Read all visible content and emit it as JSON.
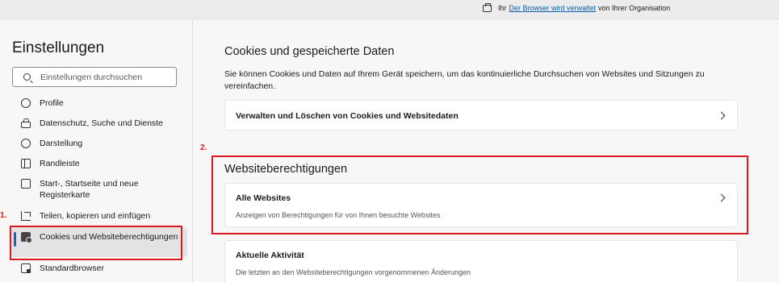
{
  "banner": {
    "prefix": "Ihr",
    "link": "Der Browser wird verwaltet",
    "suffix": "von Ihrer Organisation"
  },
  "sidebar": {
    "title": "Einstellungen",
    "search_placeholder": "Einstellungen durchsuchen",
    "items": [
      {
        "label": "Profile",
        "icon": "profile-icon"
      },
      {
        "label": "Datenschutz, Suche und Dienste",
        "icon": "lock-icon"
      },
      {
        "label": "Darstellung",
        "icon": "appearance-icon"
      },
      {
        "label": "Randleiste",
        "icon": "sidebar-icon"
      },
      {
        "label": "Start-, Startseite und neue Registerkarte",
        "icon": "start-page-icon"
      },
      {
        "label": "Teilen, kopieren und einfügen",
        "icon": "share-icon"
      },
      {
        "label": "Cookies und Websiteberechtigungen",
        "icon": "cookies-icon",
        "active": true
      },
      {
        "label": "Standardbrowser",
        "icon": "default-browser-icon"
      }
    ]
  },
  "main": {
    "cookies_heading": "Cookies und gespeicherte Daten",
    "cookies_desc": "Sie können Cookies und Daten auf Ihrem Gerät speichern, um das kontinuierliche Durchsuchen von Websites und Sitzungen zu vereinfachen.",
    "manage_cookies": "Verwalten und Löschen von Cookies und Websitedaten",
    "permissions_heading": "Websiteberechtigungen",
    "all_sites_title": "Alle Websites",
    "all_sites_desc": "Anzeigen von Berechtigungen für von Ihnen besuchte Websites",
    "recent_title": "Aktuelle Aktivität",
    "recent_desc": "Die letzten an den Websiteberechtigungen vorgenommenen Änderungen"
  },
  "annotations": {
    "step1": "1.",
    "step2": "2.",
    "highlight_color": "#d9181f"
  }
}
